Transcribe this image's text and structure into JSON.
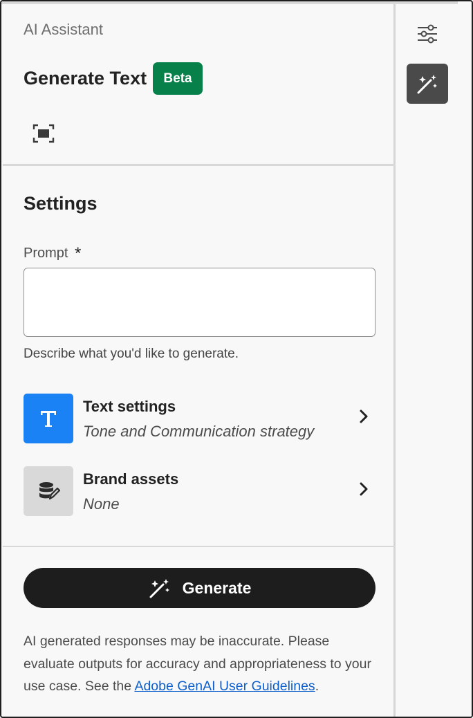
{
  "header": {
    "app_title": "AI Assistant",
    "page_title": "Generate Text",
    "badge": "Beta"
  },
  "settings": {
    "title": "Settings",
    "prompt": {
      "label": "Prompt",
      "required_marker": "*",
      "value": "",
      "placeholder": "",
      "help_text": "Describe what you'd like to generate."
    },
    "options": [
      {
        "title": "Text settings",
        "subtitle": "Tone and Communication strategy",
        "icon": "text-T-icon"
      },
      {
        "title": "Brand assets",
        "subtitle": "None",
        "icon": "brand-database-icon"
      }
    ]
  },
  "footer": {
    "generate_label": "Generate",
    "disclaimer_text": "AI generated responses may be inaccurate. Please evaluate outputs for accuracy and appropriateness to your use case. See the ",
    "link_text": "Adobe GenAI User Guidelines",
    "disclaimer_end": "."
  },
  "rail": {
    "buttons": [
      "sliders-icon",
      "magic-wand-icon"
    ]
  },
  "colors": {
    "beta_badge": "#07804a",
    "text_settings_thumb": "#1a82f4",
    "brand_thumb": "#d9d9d9",
    "generate_button": "#1d1d1d",
    "link": "#0d5fcc",
    "active_rail_button": "#4a4a4a"
  }
}
